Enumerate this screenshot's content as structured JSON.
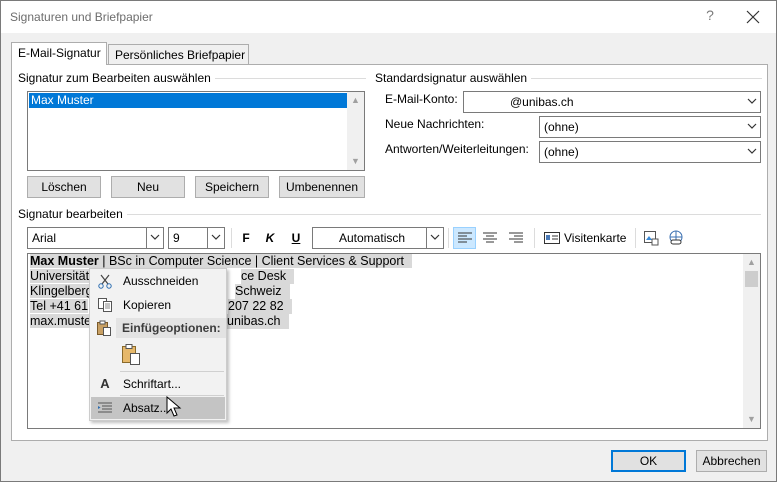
{
  "window": {
    "title": "Signaturen und Briefpapier",
    "help": "?"
  },
  "tabs": [
    {
      "label": "E-Mail-Signatur",
      "active": true
    },
    {
      "label": "Persönliches Briefpapier",
      "active": false
    }
  ],
  "select_section": {
    "label": "Signatur zum Bearbeiten auswählen",
    "signatures": [
      "Max Muster"
    ],
    "buttons": {
      "delete": "Löschen",
      "new": "Neu",
      "save": "Speichern",
      "rename": "Umbenennen"
    }
  },
  "default_section": {
    "label": "Standardsignatur auswählen",
    "account_label": "E-Mail-Konto:",
    "account_value": "@unibas.ch",
    "new_messages_label": "Neue Nachrichten:",
    "new_messages_value": "(ohne)",
    "replies_label": "Antworten/Weiterleitungen:",
    "replies_value": "(ohne)"
  },
  "edit_section": {
    "label": "Signatur bearbeiten",
    "font": "Arial",
    "size": "9",
    "bold": "F",
    "italic": "K",
    "underline": "U",
    "color": "Automatisch",
    "business_card": "Visitenkarte"
  },
  "signature_text": {
    "line1_bold": "Max Muster",
    "line1_rest": " | BSc in Computer Science | Client Services & Support",
    "line2_left": "Universität",
    "line2_right": "ce Desk",
    "line3_left": "Klingelberg",
    "line3_right": "Schweiz",
    "line4_left": "Tel +41 61",
    "line4_right": "207 22 82",
    "line5_left": "max.muste",
    "line5_right": "unibas.ch"
  },
  "context_menu": {
    "cut": "Ausschneiden",
    "copy": "Kopieren",
    "paste_options": "Einfügeoptionen:",
    "font": "Schriftart...",
    "paragraph": "Absatz..."
  },
  "footer": {
    "ok": "OK",
    "cancel": "Abbrechen"
  },
  "colors": {
    "accent": "#0078d7",
    "selection_gray": "#d9d9d9"
  }
}
